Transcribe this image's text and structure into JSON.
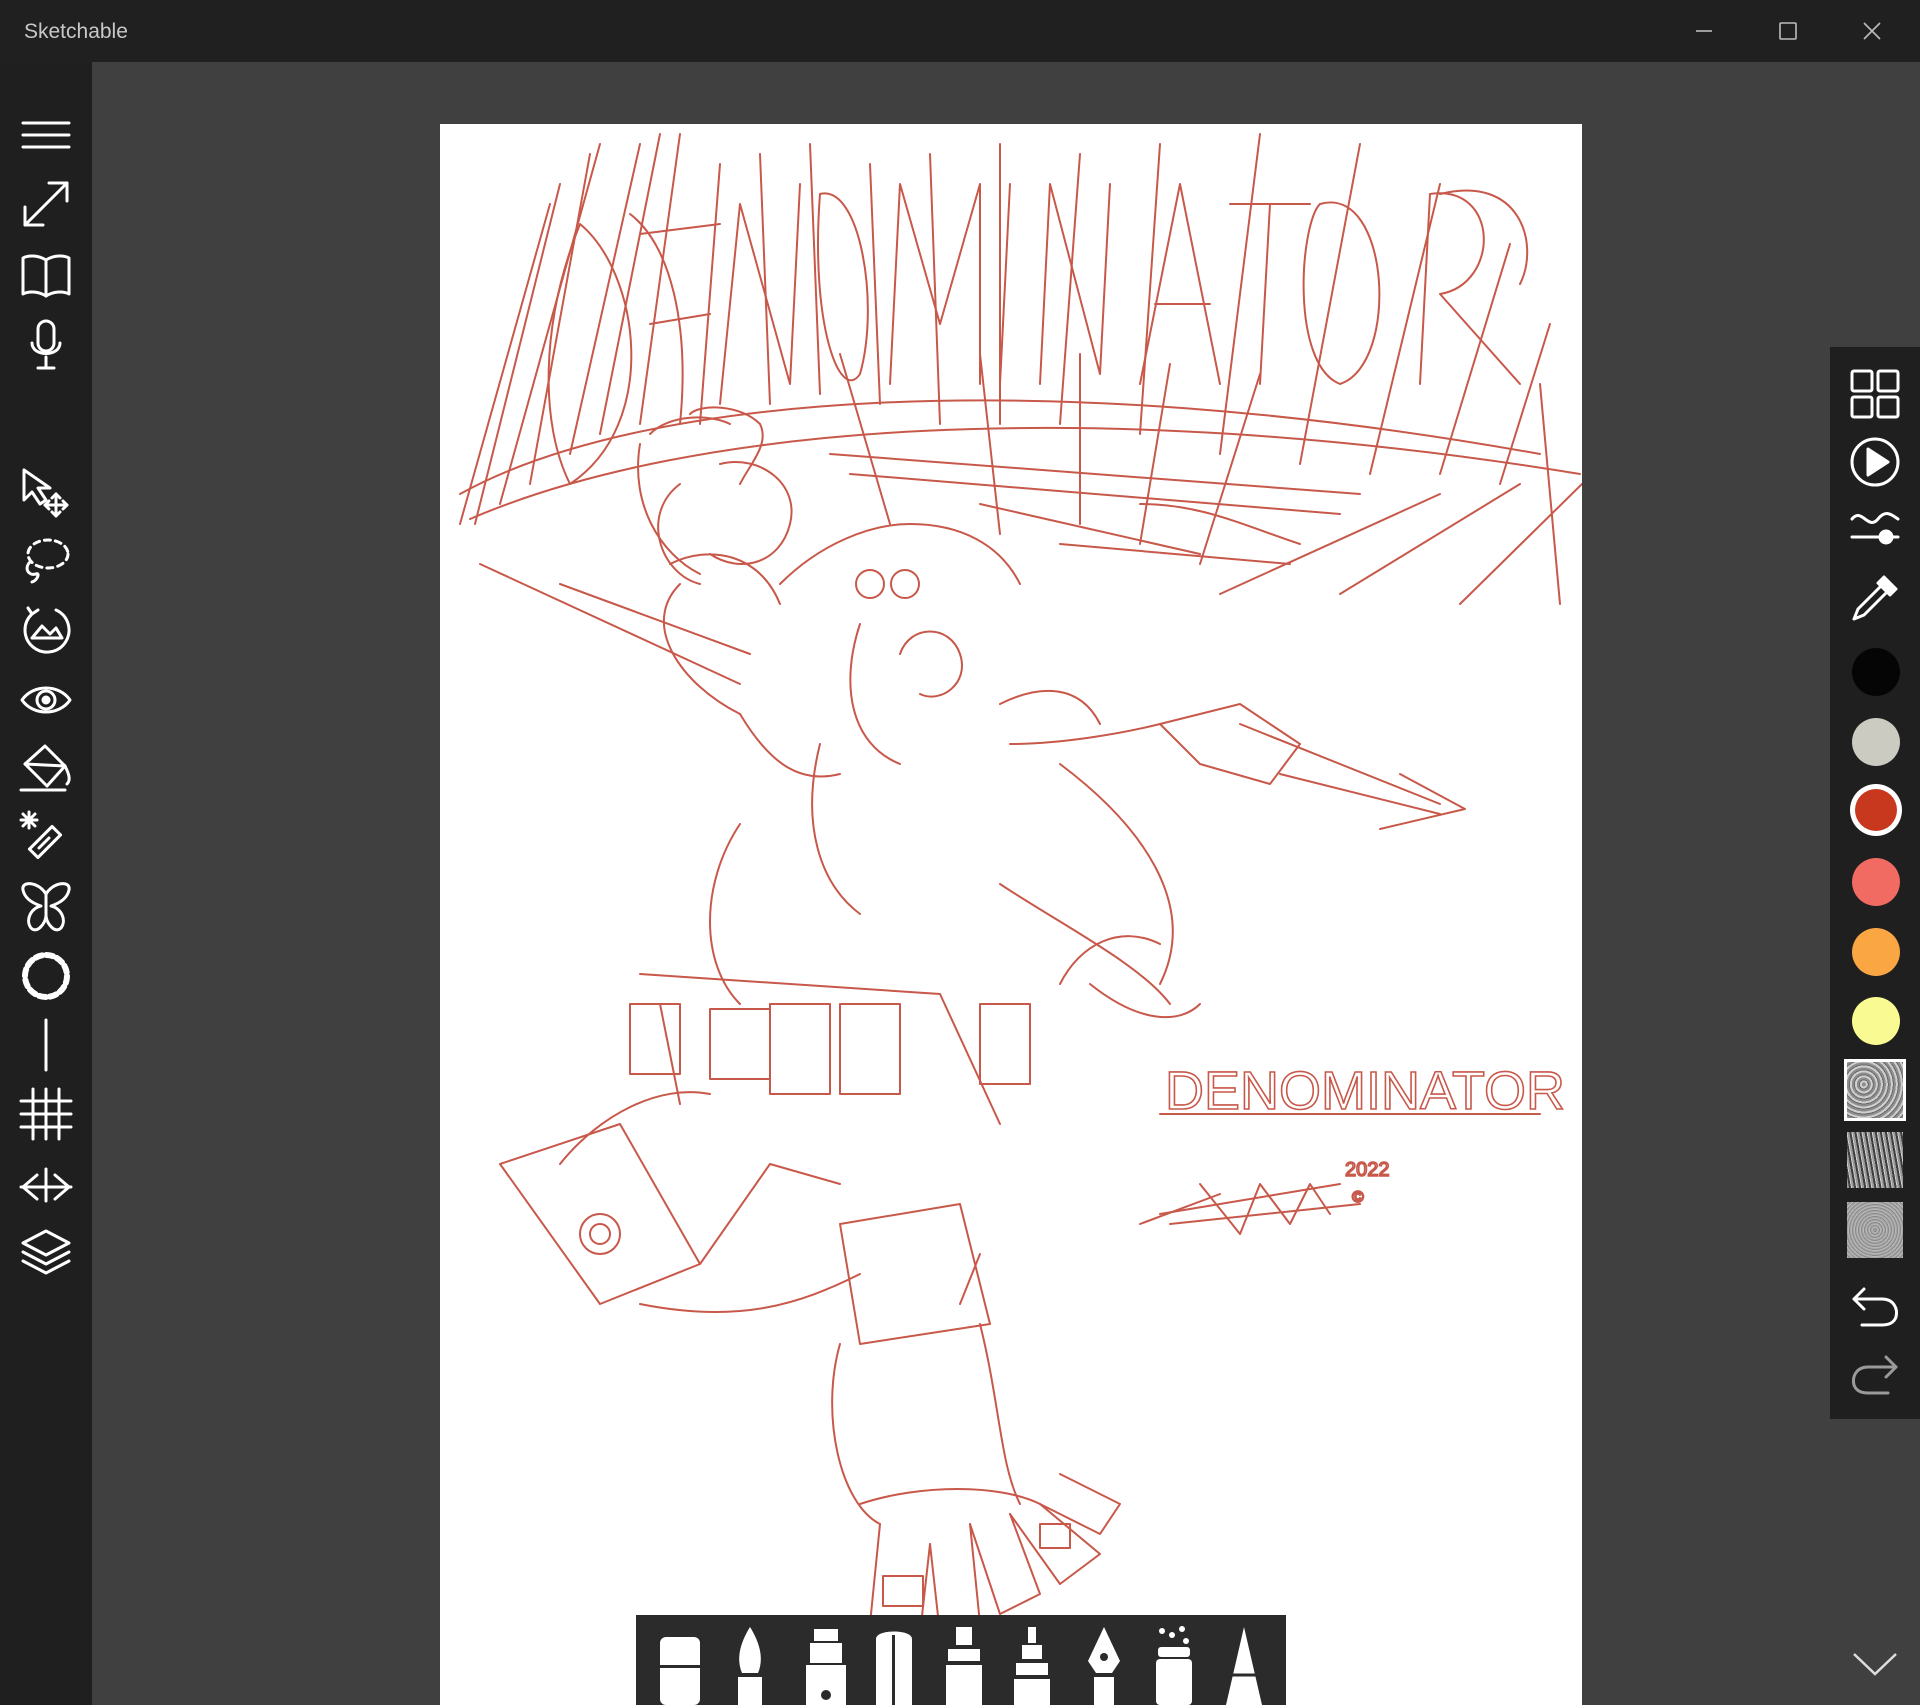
{
  "window": {
    "title": "Sketchable"
  },
  "artwork": {
    "title_text": "DENOMINATOR",
    "signature_text": "DENOMINATOR",
    "signature_year": "2022",
    "signature_copyright": "©",
    "stroke_color": "#c8584a"
  },
  "left_toolbar": {
    "items": [
      "menu",
      "fullscreen",
      "journal",
      "microphone",
      "select-transform",
      "lasso",
      "adjust-image",
      "visibility",
      "fill-bucket",
      "magic-wand",
      "symmetry",
      "circle-guide",
      "line-guide",
      "grid",
      "perspective",
      "layers"
    ]
  },
  "right_panel": {
    "tools": [
      "gallery",
      "play",
      "stroke-settings",
      "eyedropper"
    ],
    "colors": [
      "#050505",
      "#cbcbc2",
      "#c8381e",
      "#f26b62",
      "#f9a643",
      "#fafa92"
    ],
    "selected_color": "#c8381e",
    "textures": [
      "texture-1",
      "texture-2",
      "texture-3"
    ],
    "actions": [
      "undo",
      "redo"
    ]
  },
  "brush_bar": {
    "brushes": [
      "eraser",
      "paintbrush",
      "marker",
      "pencil",
      "highlighter",
      "crayon",
      "fountain-pen",
      "spray-can",
      "pencil-sharp"
    ]
  }
}
